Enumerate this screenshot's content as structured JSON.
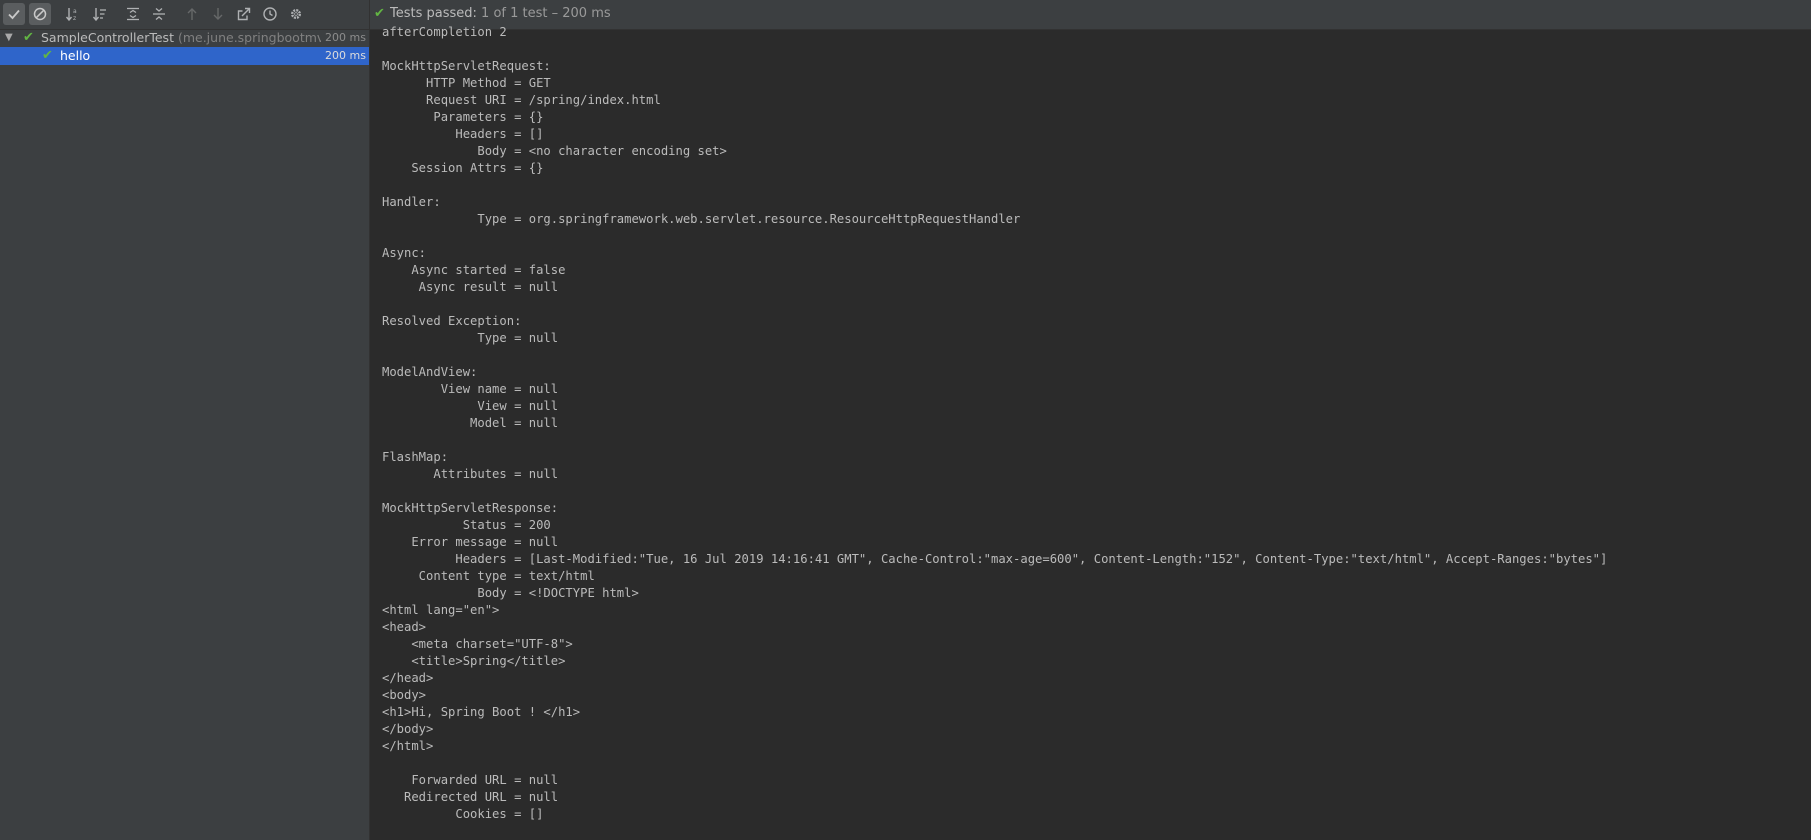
{
  "toolbar": {
    "buttons": [
      {
        "icon": "show-passed-icon",
        "toggled": true
      },
      {
        "icon": "show-ignored-icon",
        "toggled": true
      },
      {
        "icon": "sort-alphabetically-icon",
        "toggled": false
      },
      {
        "icon": "sort-by-duration-icon",
        "toggled": false
      },
      {
        "icon": "expand-all-icon",
        "toggled": false
      },
      {
        "icon": "collapse-all-icon",
        "toggled": false
      },
      {
        "icon": "previous-failed-icon",
        "toggled": false
      },
      {
        "icon": "next-failed-icon",
        "toggled": false
      },
      {
        "icon": "export-results-icon",
        "toggled": false
      },
      {
        "icon": "test-history-icon",
        "toggled": false
      },
      {
        "icon": "settings-gear-icon",
        "toggled": false
      }
    ]
  },
  "tree": {
    "suite": {
      "name": "SampleControllerTest",
      "package": "(me.june.springbootmvc",
      "time": "200 ms"
    },
    "test": {
      "name": "hello",
      "time": "200 ms"
    }
  },
  "status": {
    "label": "Tests passed:",
    "detail": "1 of 1 test",
    "separator": "–",
    "time": "200 ms"
  },
  "console": {
    "lines": [
      "afterCompletion 2",
      "",
      "MockHttpServletRequest:",
      "      HTTP Method = GET",
      "      Request URI = /spring/index.html",
      "       Parameters = {}",
      "          Headers = []",
      "             Body = <no character encoding set>",
      "    Session Attrs = {}",
      "",
      "Handler:",
      "             Type = org.springframework.web.servlet.resource.ResourceHttpRequestHandler",
      "",
      "Async:",
      "    Async started = false",
      "     Async result = null",
      "",
      "Resolved Exception:",
      "             Type = null",
      "",
      "ModelAndView:",
      "        View name = null",
      "             View = null",
      "            Model = null",
      "",
      "FlashMap:",
      "       Attributes = null",
      "",
      "MockHttpServletResponse:",
      "           Status = 200",
      "    Error message = null",
      "          Headers = [Last-Modified:\"Tue, 16 Jul 2019 14:16:41 GMT\", Cache-Control:\"max-age=600\", Content-Length:\"152\", Content-Type:\"text/html\", Accept-Ranges:\"bytes\"]",
      "     Content type = text/html",
      "             Body = <!DOCTYPE html>",
      "<html lang=\"en\">",
      "<head>",
      "    <meta charset=\"UTF-8\">",
      "    <title>Spring</title>",
      "</head>",
      "<body>",
      "<h1>Hi, Spring Boot ! </h1>",
      "</body>",
      "</html>",
      "",
      "    Forwarded URL = null",
      "   Redirected URL = null",
      "          Cookies = []"
    ]
  },
  "colors": {
    "pass_green": "#62b543",
    "selection_blue": "#2f65ca",
    "panel_bg": "#3c3f41",
    "console_bg": "#2b2b2b",
    "text": "#bbbbbb"
  }
}
